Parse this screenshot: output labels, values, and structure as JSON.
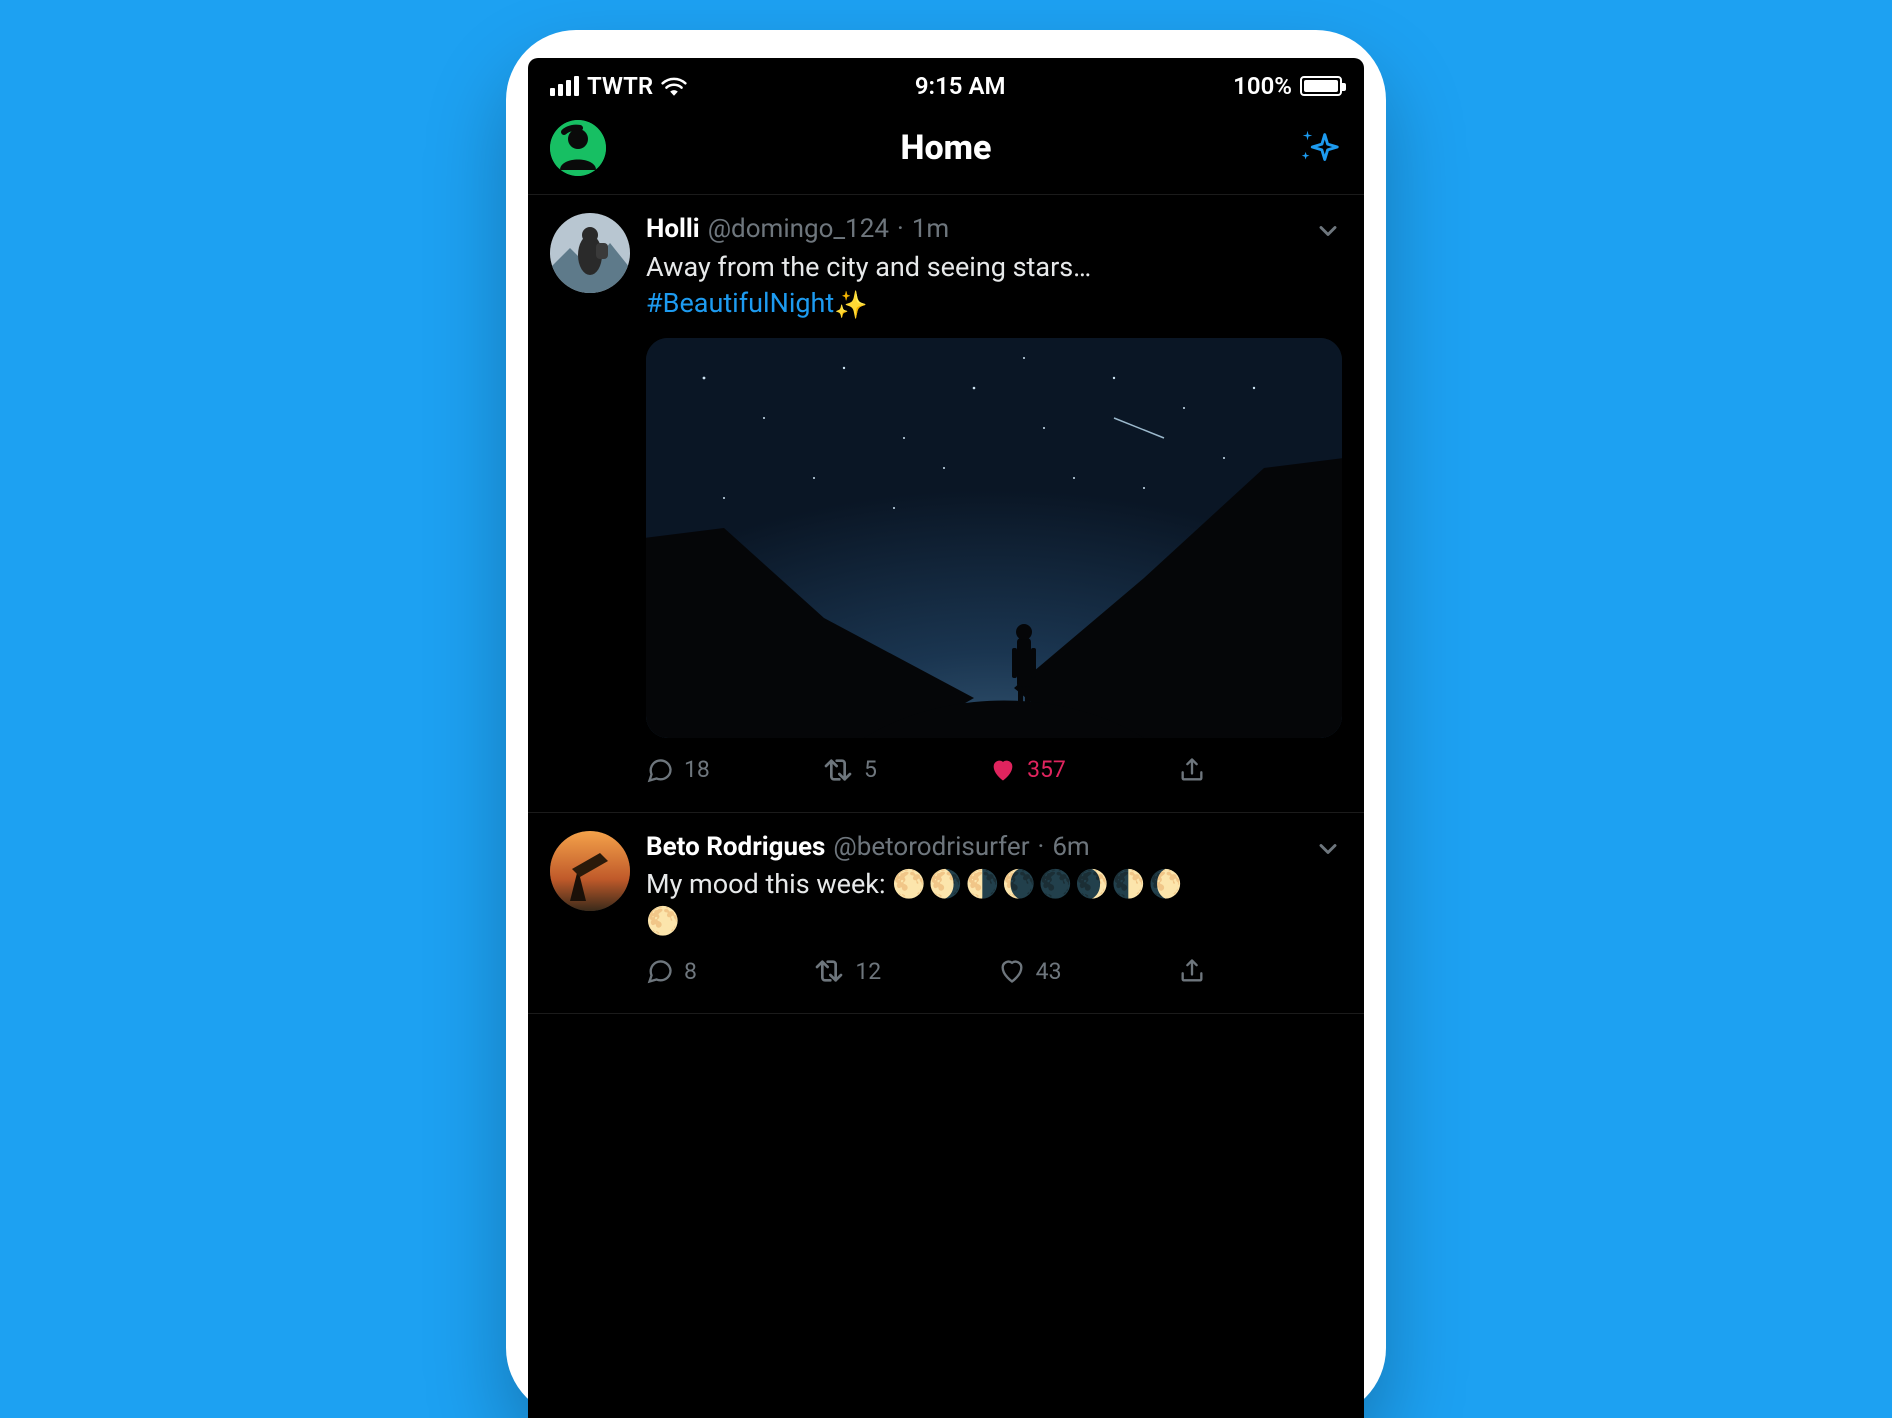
{
  "status_bar": {
    "carrier": "TWTR",
    "time": "9:15 AM",
    "battery_text": "100%"
  },
  "header": {
    "title": "Home"
  },
  "tweets": [
    {
      "display_name": "Holli",
      "handle": "@domingo_124",
      "time": "1m",
      "text": "Away from the city and seeing stars…",
      "hashtag": "#BeautifulNight",
      "emoji": "✨",
      "replies": "18",
      "retweets": "5",
      "likes": "357",
      "liked": true
    },
    {
      "display_name": "Beto Rodrigues",
      "handle": "@betorodrisurfer",
      "time": "6m",
      "text_prefix": "My mood this week: ",
      "moons_line1": "🌕🌖🌗🌘🌑🌒🌓🌔",
      "moons_line2": "🌕",
      "replies": "8",
      "retweets": "12",
      "likes": "43",
      "liked": false
    }
  ]
}
